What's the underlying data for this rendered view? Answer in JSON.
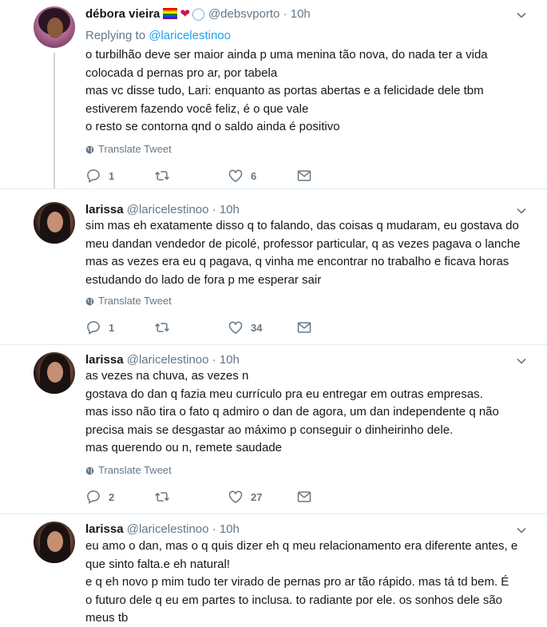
{
  "tweets": [
    {
      "name": "débora vieira",
      "handle": "@debsvporto",
      "dot": "·",
      "time": "10h",
      "replying_label": "Replying to",
      "replying_mention": "@laricelestinoo",
      "lines": [
        "o turbilhão deve ser maior ainda p uma menina tão nova, do nada ter a vida",
        "colocada d pernas pro ar, por tabela",
        "mas vc disse tudo, Lari: enquanto as portas abertas e a felicidade dele tbm",
        "estiverem fazendo você feliz, é o que vale",
        "o resto se contorna qnd o saldo ainda é positivo"
      ],
      "translate": "Translate Tweet",
      "replies": "1",
      "retweets": "",
      "likes": "6"
    },
    {
      "name": "larissa",
      "handle": "@laricelestinoo",
      "dot": "·",
      "time": "10h",
      "lines": [
        "sim mas eh exatamente disso q to falando, das coisas q mudaram, eu gostava do",
        "meu dandan vendedor de picolé, professor particular, q as vezes pagava o lanche",
        "mas as vezes era eu q pagava, q vinha me encontrar no trabalho e ficava horas",
        "estudando do lado de fora p me esperar sair"
      ],
      "translate": "Translate Tweet",
      "replies": "1",
      "retweets": "",
      "likes": "34"
    },
    {
      "name": "larissa",
      "handle": "@laricelestinoo",
      "dot": "·",
      "time": "10h",
      "lines": [
        "as vezes na chuva, as vezes n",
        "gostava do dan q fazia meu currículo pra eu entregar em outras empresas.",
        "mas isso não tira o fato q admiro o dan de agora, um dan independente q não",
        "precisa mais se desgastar ao máximo p conseguir o dinheirinho dele.",
        "mas querendo ou n, remete saudade"
      ],
      "translate": "Translate Tweet",
      "replies": "2",
      "retweets": "",
      "likes": "27"
    },
    {
      "name": "larissa",
      "handle": "@laricelestinoo",
      "dot": "·",
      "time": "10h",
      "lines": [
        "eu amo o dan, mas o q quis dizer eh q meu relacionamento era diferente antes, e",
        "que sinto falta.e eh natural!",
        "e q eh novo p mim tudo ter virado de pernas pro ar tão rápido. mas tá td bem. É",
        "o futuro dele q eu em partes to inclusa. to radiante por ele. os sonhos dele são",
        "meus tb"
      ]
    }
  ],
  "icons": {
    "reply": "reply-icon",
    "retweet": "retweet-icon",
    "like": "heart-icon",
    "dm": "envelope-icon",
    "translate": "globe-icon",
    "more": "chevron-down-icon"
  },
  "colors": {
    "link": "#1da1f2",
    "secondary_text": "#657786",
    "thread_line": "#ccd6dd",
    "divider": "#e6ecf0"
  }
}
